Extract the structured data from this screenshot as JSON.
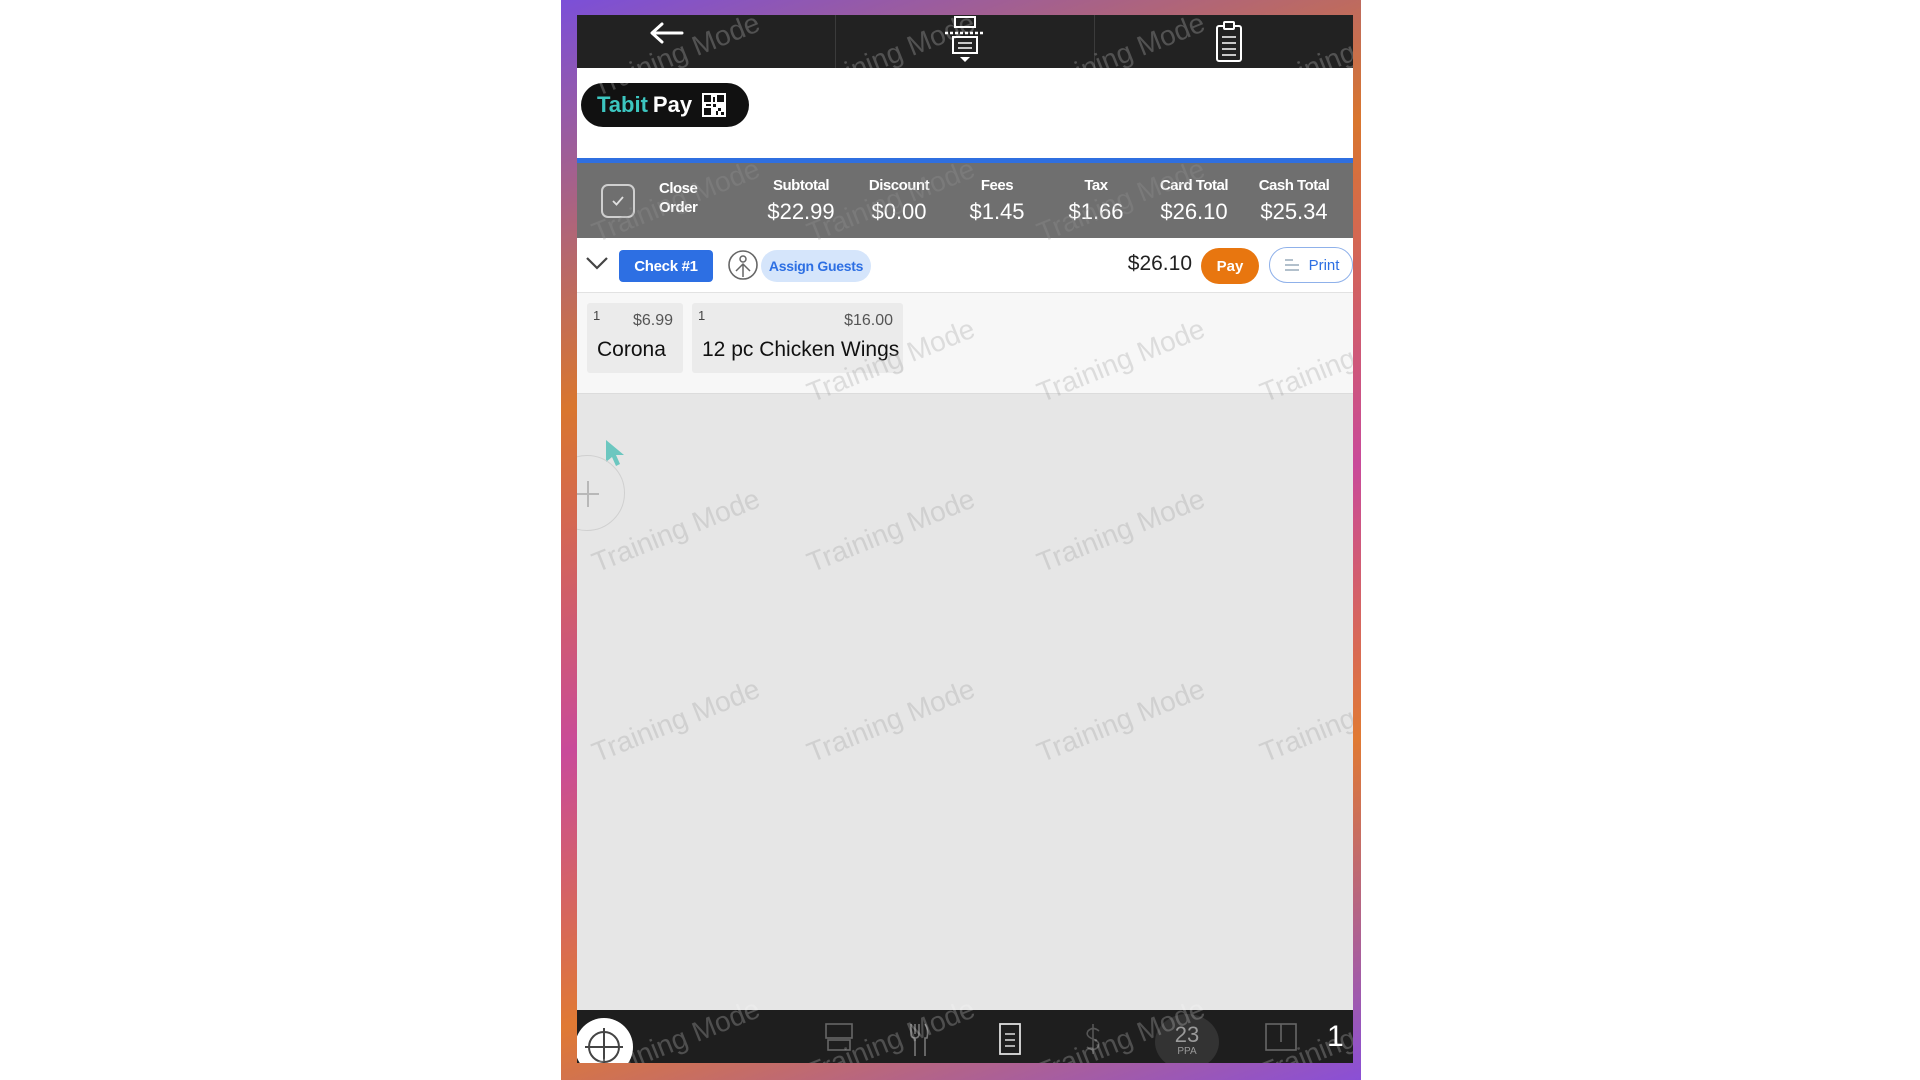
{
  "watermark": "Training Mode",
  "brand": {
    "name_part1": "Tabit",
    "name_part2": "Pay"
  },
  "totals": {
    "close_order_label": "Close Order",
    "columns": [
      {
        "label": "Subtotal",
        "value": "$22.99"
      },
      {
        "label": "Discount",
        "value": "$0.00"
      },
      {
        "label": "Fees",
        "value": "$1.45"
      },
      {
        "label": "Tax",
        "value": "$1.66"
      },
      {
        "label": "Card Total",
        "value": "$26.10"
      },
      {
        "label": "Cash Total",
        "value": "$25.34"
      }
    ]
  },
  "check": {
    "label": "Check #1",
    "assign_guests_label": "Assign Guests",
    "total": "$26.10",
    "pay_label": "Pay",
    "print_label": "Print"
  },
  "items": [
    {
      "qty": "1",
      "price": "$6.99",
      "name": "Corona"
    },
    {
      "qty": "1",
      "price": "$16.00",
      "name": "12 pc Chicken Wings"
    }
  ],
  "bottom": {
    "ppa_value": "23",
    "ppa_label": "PPA",
    "counter": "1"
  },
  "colors": {
    "accent_blue": "#2d6fe3",
    "pay_orange": "#e8760f",
    "brand_teal": "#3cc6c0",
    "totals_bar": "#6f6f6f"
  },
  "icons": {
    "top": [
      "back-arrow-icon",
      "printer-icon",
      "clipboard-icon"
    ],
    "bottom": [
      "target-icon",
      "register-icon",
      "fork-icon",
      "receipt-icon",
      "dollar-icon",
      "ppa-icon",
      "floorplan-icon"
    ]
  }
}
